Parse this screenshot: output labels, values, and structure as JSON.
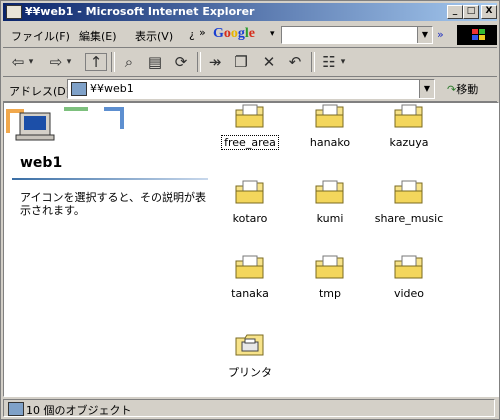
{
  "window": {
    "title": "¥¥web1 - Microsoft Internet Explorer",
    "min": "_",
    "max": "□",
    "close": "X"
  },
  "menu": {
    "items": [
      "ファイル(F)",
      "編集(E)",
      "表示(V)",
      "¿"
    ],
    "overflow": "»",
    "google_label": "Google",
    "google_dd": "▾",
    "search_value": "",
    "more": "»"
  },
  "toolbar": {
    "back": "⇦",
    "back_dd": "▾",
    "forward": "⇨",
    "forward_dd": "▾",
    "up": "↑",
    "search": "⌕",
    "folders": "▤",
    "history": "⟳",
    "move": "↠",
    "copy": "❐",
    "delete": "✕",
    "undo": "↶",
    "views": "☷",
    "views_dd": "▾"
  },
  "address": {
    "label": "アドレス(D)",
    "value": "¥¥web1",
    "go_label": "移動",
    "go_icon": "↷"
  },
  "leftpane": {
    "folder_title": "web1",
    "description": "アイコンを選択すると、その説明が表示されます。"
  },
  "items": [
    {
      "label": "free_area",
      "type": "folder",
      "selected": true
    },
    {
      "label": "hanako",
      "type": "folder"
    },
    {
      "label": "kazuya",
      "type": "folder"
    },
    {
      "label": "kotaro",
      "type": "folder"
    },
    {
      "label": "kumi",
      "type": "folder"
    },
    {
      "label": "share_music",
      "type": "folder"
    },
    {
      "label": "tanaka",
      "type": "folder"
    },
    {
      "label": "tmp",
      "type": "folder"
    },
    {
      "label": "video",
      "type": "folder"
    },
    {
      "label": "プリンタ",
      "type": "printers"
    }
  ],
  "status": {
    "text": "10 個のオブジェクト"
  },
  "colors": {
    "titlebar": "#0a246a",
    "face": "#d4d0c8",
    "folder": "#f7e38a"
  }
}
